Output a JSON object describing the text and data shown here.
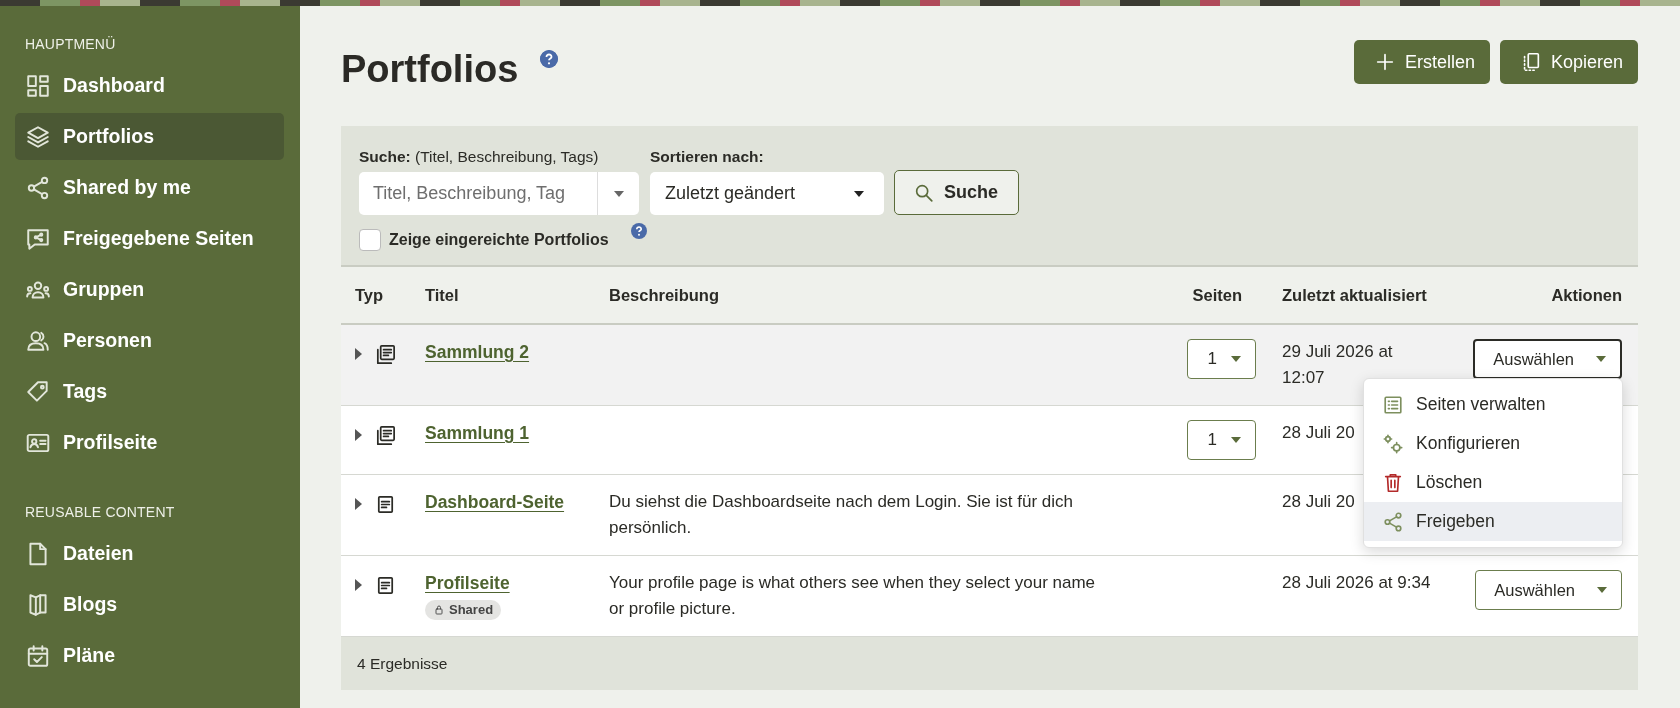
{
  "sidebar": {
    "sections": [
      {
        "heading": "HAUPTMENÜ",
        "items": [
          {
            "label": "Dashboard",
            "kind": "dashboard",
            "selected": false
          },
          {
            "label": "Portfolios",
            "kind": "layers",
            "selected": true
          },
          {
            "label": "Shared by me",
            "kind": "share",
            "selected": false
          },
          {
            "label": "Freigegebene Seiten",
            "kind": "chat",
            "selected": false
          },
          {
            "label": "Gruppen",
            "kind": "group",
            "selected": false
          },
          {
            "label": "Personen",
            "kind": "people",
            "selected": false
          },
          {
            "label": "Tags",
            "kind": "tag",
            "selected": false
          },
          {
            "label": "Profilseite",
            "kind": "card",
            "selected": false
          }
        ]
      },
      {
        "heading": "REUSABLE CONTENT",
        "items": [
          {
            "label": "Dateien",
            "kind": "file",
            "selected": false
          },
          {
            "label": "Blogs",
            "kind": "book",
            "selected": false
          },
          {
            "label": "Pläne",
            "kind": "calendar",
            "selected": false
          }
        ]
      }
    ]
  },
  "header": {
    "title": "Portfolios",
    "buttons": [
      {
        "label": "Erstellen",
        "kind": "add"
      },
      {
        "label": "Kopieren",
        "kind": "copy"
      }
    ]
  },
  "search": {
    "label": "Suche:",
    "hint": "(Titel, Beschreibung, Tags)",
    "placeholder": "Titel, Beschreibung, Tag",
    "sort_label": "Sortieren nach:",
    "sort_value": "Zuletzt geändert",
    "button": "Suche",
    "checkbox": {
      "label": "Zeige eingereichte Portfolios",
      "checked": false
    }
  },
  "table": {
    "columns": [
      "Typ",
      "Titel",
      "Beschreibung",
      "Seiten",
      "Zuletzt aktualisiert",
      "Aktionen"
    ],
    "rows": [
      {
        "kind": "collection",
        "highlighted": true,
        "title": "Sammlung 2",
        "pages": "1",
        "updated": "29 Juli 2026 at 12:07",
        "action": {
          "label": "Auswählen",
          "focused": true
        }
      },
      {
        "kind": "collection",
        "highlighted": false,
        "title": "Sammlung 1",
        "pages": "1",
        "updated": "28 Juli 20"
      },
      {
        "kind": "page",
        "highlighted": false,
        "title": "Dashboard-Seite",
        "description": "Du siehst die Dashboardseite nach dem Login. Sie ist für dich persönlich.",
        "updated": "28 Juli 20"
      },
      {
        "kind": "page",
        "highlighted": false,
        "title": "Profilseite",
        "tags": [
          "Shared"
        ],
        "description": "Your profile page is what others see when they select your name or profile picture.",
        "updated": "28 Juli 2026 at 9:34",
        "action": {
          "label": "Auswählen",
          "focused": false
        }
      }
    ],
    "footer": "4 Ergebnisse"
  },
  "menu": {
    "items": [
      {
        "label": "Seiten verwalten",
        "kind": "list",
        "highlighted": false
      },
      {
        "label": "Konfigurieren",
        "kind": "gears",
        "highlighted": false
      },
      {
        "label": "Löschen",
        "kind": "trash",
        "highlighted": false
      },
      {
        "label": "Freigeben",
        "kind": "share",
        "highlighted": true
      }
    ]
  }
}
